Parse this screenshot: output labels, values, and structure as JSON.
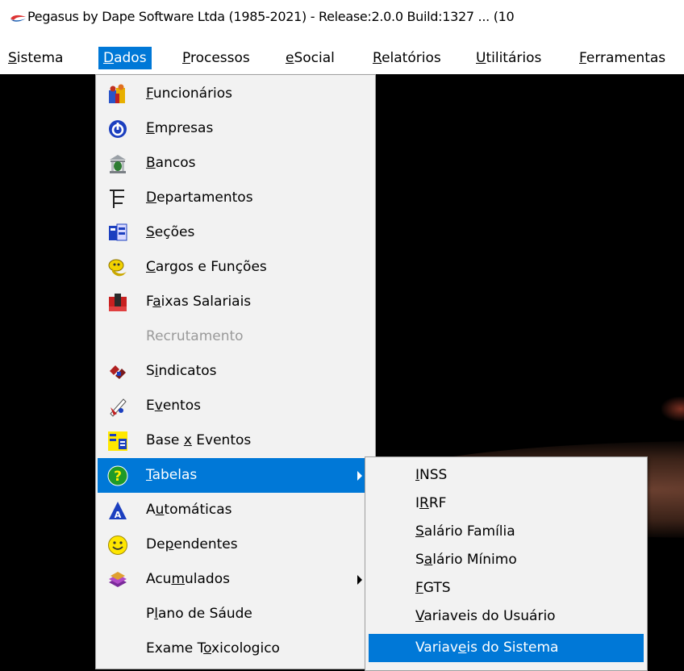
{
  "window": {
    "title": "Pegasus by Dape Software Ltda (1985-2021) - Release:2.0.0  Build:1327 ... (10"
  },
  "menubar": {
    "items": [
      {
        "pre": "",
        "u": "S",
        "post": "istema"
      },
      {
        "pre": "",
        "u": "D",
        "post": "ados"
      },
      {
        "pre": "",
        "u": "P",
        "post": "rocessos"
      },
      {
        "pre": "",
        "u": "e",
        "post": "Social"
      },
      {
        "pre": "",
        "u": "R",
        "post": "elatórios"
      },
      {
        "pre": "",
        "u": "U",
        "post": "tilitários"
      },
      {
        "pre": "",
        "u": "F",
        "post": "erramentas"
      }
    ]
  },
  "dados_menu": {
    "items": [
      {
        "pre": "",
        "u": "F",
        "post": "uncionários",
        "icon": "employees-icon"
      },
      {
        "pre": "",
        "u": "E",
        "post": "mpresas",
        "icon": "power-icon"
      },
      {
        "pre": "",
        "u": "B",
        "post": "ancos",
        "icon": "bank-icon"
      },
      {
        "pre": "",
        "u": "D",
        "post": "epartamentos",
        "icon": "org-tree-icon"
      },
      {
        "pre": "",
        "u": "S",
        "post": "eções",
        "icon": "sections-icon"
      },
      {
        "pre": "",
        "u": "C",
        "post": "argos e Funções",
        "icon": "roles-icon"
      },
      {
        "pre": "F",
        "u": "a",
        "post": "ixas Salariais",
        "icon": "salary-bands-icon"
      },
      {
        "pre": "",
        "u": "R",
        "post": "ecrutamento",
        "icon": "",
        "disabled": true
      },
      {
        "pre": "S",
        "u": "i",
        "post": "ndicatos",
        "icon": "unions-icon"
      },
      {
        "pre": "E",
        "u": "v",
        "post": "entos",
        "icon": "events-icon"
      },
      {
        "pre": "Base ",
        "u": "x",
        "post": " Eventos",
        "icon": "base-events-icon"
      },
      {
        "pre": "",
        "u": "T",
        "post": "abelas",
        "icon": "help-icon",
        "submenu": true,
        "highlighted": true
      },
      {
        "pre": "A",
        "u": "u",
        "post": "tomáticas",
        "icon": "automatic-icon"
      },
      {
        "pre": "De",
        "u": "p",
        "post": "endentes",
        "icon": "smiley-icon"
      },
      {
        "pre": "Acu",
        "u": "m",
        "post": "ulados",
        "icon": "accumulated-icon",
        "submenu": true
      },
      {
        "pre": "P",
        "u": "l",
        "post": "ano de Sáude",
        "icon": ""
      },
      {
        "pre": "Exame T",
        "u": "o",
        "post": "xicologico",
        "icon": ""
      }
    ]
  },
  "tabelas_menu": {
    "items": [
      {
        "pre": "",
        "u": "I",
        "post": "NSS"
      },
      {
        "pre": "I",
        "u": "R",
        "post": "RF"
      },
      {
        "pre": "",
        "u": "S",
        "post": "alário Família"
      },
      {
        "pre": "S",
        "u": "a",
        "post": "lário Mínimo"
      },
      {
        "pre": "",
        "u": "F",
        "post": "GTS"
      },
      {
        "pre": "",
        "u": "V",
        "post": "ariaveis do Usuário"
      },
      {
        "pre": "Variav",
        "u": "e",
        "post": "is do Sistema",
        "highlighted": true
      }
    ]
  },
  "colors": {
    "highlight": "#0078d7",
    "menu_bg": "#f2f2f2",
    "workspace": "#000000"
  }
}
